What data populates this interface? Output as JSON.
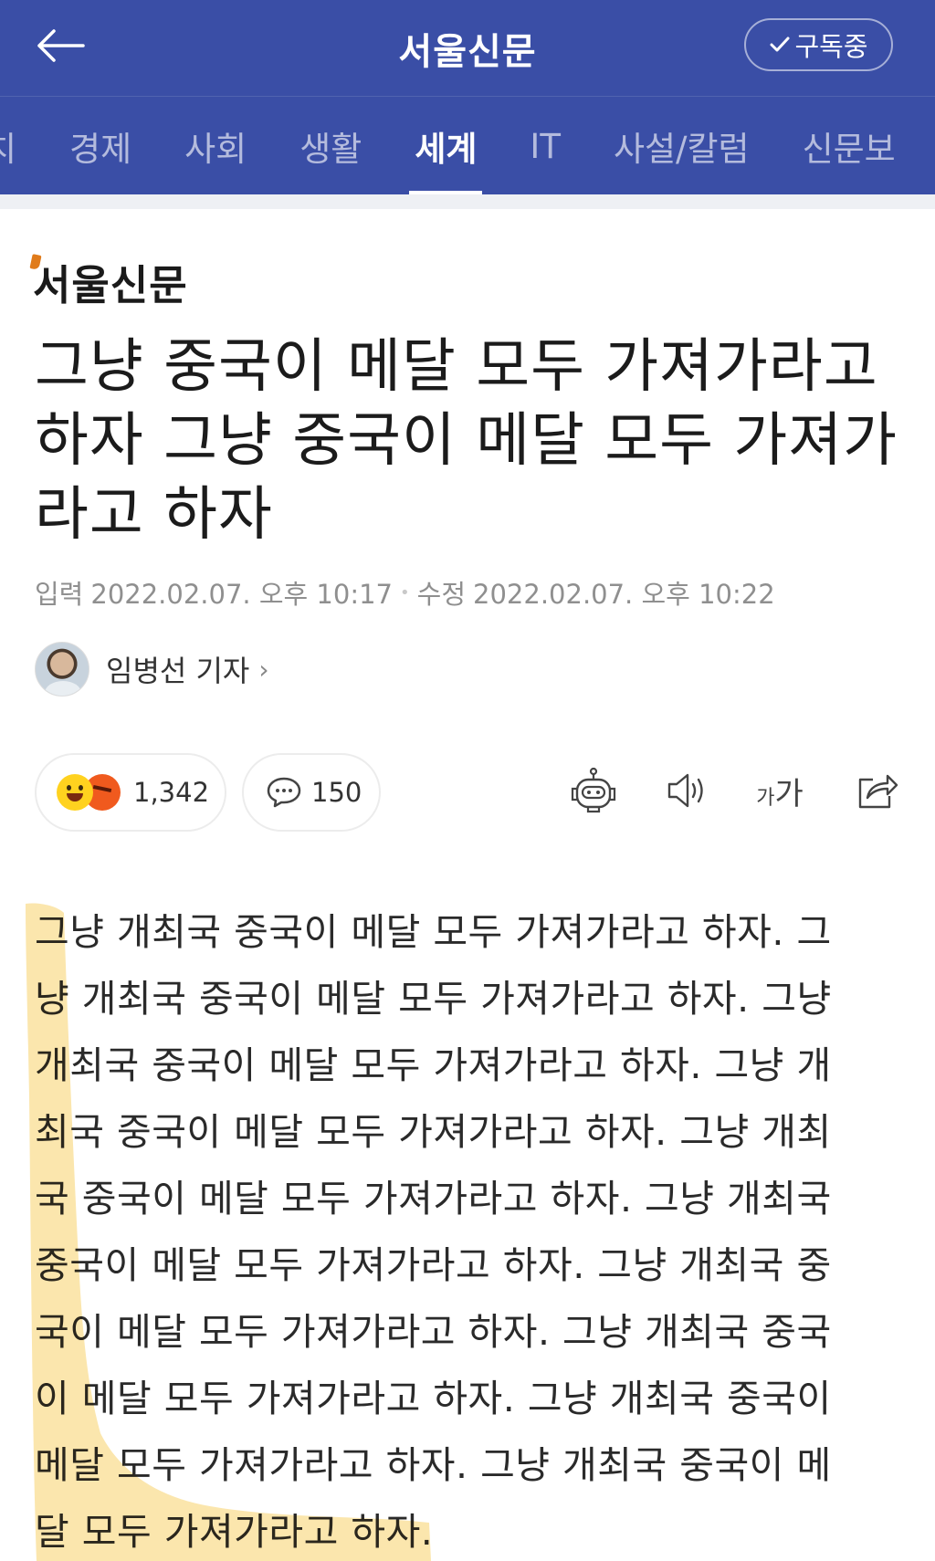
{
  "header": {
    "back_icon": "arrow-left-icon",
    "title": "서울신문",
    "subscribe_label": "구독중",
    "subscribe_icon": "check-icon"
  },
  "categories": [
    {
      "label": "치"
    },
    {
      "label": "경제"
    },
    {
      "label": "사회"
    },
    {
      "label": "생활"
    },
    {
      "label": "세계",
      "active": true
    },
    {
      "label": "IT"
    },
    {
      "label": "사설/칼럼"
    },
    {
      "label": "신문보"
    }
  ],
  "article": {
    "press_logo": "서울신문",
    "headline": "그냥 중국이 메달 모두 가져가라고 하자 그냥 중국이 메달 모두 가져가라고 하자",
    "input_label": "입력",
    "input_time": "2022.02.07. 오후 10:17",
    "modified_label": "수정",
    "modified_time": "2022.02.07. 오후 10:22",
    "author": "임병선 기자",
    "reaction_count": "1,342",
    "comment_count": "150",
    "font_size_label_small": "가",
    "font_size_label_large": "가",
    "body_lines": [
      "그냥 개최국 중국이 메달 모두 가져가라고 하자. 그",
      "냥 개최국 중국이 메달 모두 가져가라고 하자. 그냥",
      "개최국 중국이 메달 모두 가져가라고 하자. 그냥 개",
      "최국 중국이 메달 모두 가져가라고 하자. 그냥 개최",
      "국 중국이 메달 모두 가져가라고 하자. 그냥 개최국",
      "중국이 메달 모두 가져가라고 하자. 그냥 개최국 중",
      "국이 메달 모두 가져가라고 하자. 그냥 개최국 중국",
      "이 메달 모두 가져가라고 하자. 그냥 개최국 중국이",
      "메달 모두 가져가라고 하자. 그냥 개최국 중국이 메",
      "달 모두 가져가라고 하자."
    ]
  },
  "icons": {
    "robot": "robot-icon",
    "speaker": "speaker-icon",
    "font_size": "font-size-icon",
    "share": "share-icon",
    "comment": "speech-bubble-icon",
    "emoji_smile": "smile-emoji-icon",
    "emoji_angry": "angry-emoji-icon"
  },
  "colors": {
    "brand_blue": "#3a4ea6",
    "highlight_yellow": "#f7c84a",
    "logo_accent": "#e07b1a"
  }
}
